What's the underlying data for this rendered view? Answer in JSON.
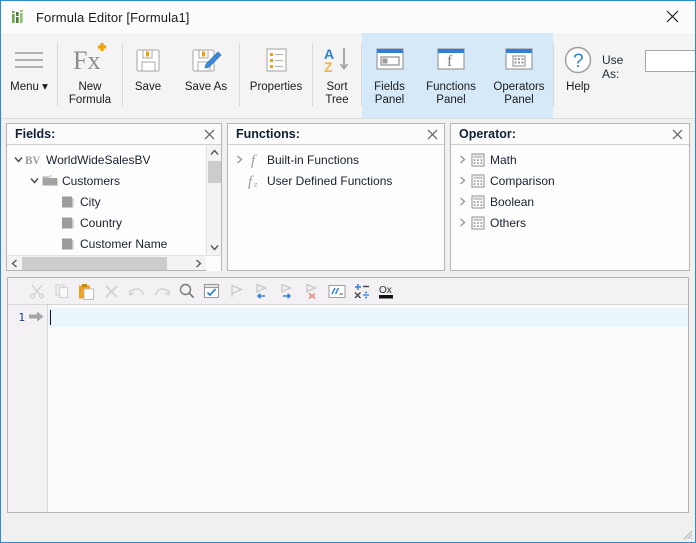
{
  "window": {
    "title": "Formula Editor [Formula1]",
    "app_icon": "bar-chart-icon",
    "close_label": "✕",
    "accent_color": "#2e8bd0"
  },
  "ribbon": {
    "items": [
      {
        "id": "menu",
        "icon": "hamburger-menu-icon",
        "label": "Menu ▾",
        "active": false
      },
      {
        "id": "new-formula",
        "icon": "fx-plus-icon",
        "label": "New\nFormula",
        "active": false
      },
      {
        "id": "save",
        "icon": "floppy-disk-icon",
        "label": "Save",
        "active": false
      },
      {
        "id": "save-as",
        "icon": "floppy-pencil-icon",
        "label": "Save As",
        "active": false
      },
      {
        "id": "properties",
        "icon": "list-properties-icon",
        "label": "Properties",
        "active": false
      },
      {
        "id": "sort-tree",
        "icon": "sort-az-icon",
        "label": "Sort\nTree",
        "active": false
      },
      {
        "id": "fields-panel",
        "icon": "fields-window-icon",
        "label": "Fields\nPanel",
        "active": true
      },
      {
        "id": "functions-panel",
        "icon": "function-window-icon",
        "label": "Functions\nPanel",
        "active": true
      },
      {
        "id": "operators-panel",
        "icon": "calculator-window-icon",
        "label": "Operators\nPanel",
        "active": true
      },
      {
        "id": "help",
        "icon": "question-circle-icon",
        "label": "Help",
        "active": false
      }
    ],
    "use_as": {
      "label": "Use As:",
      "value": "",
      "placeholder": "",
      "dropdown_icon": "chevron-down-icon"
    }
  },
  "panels": [
    {
      "id": "fields",
      "title": "Fields:",
      "close_icon": "close-icon",
      "has_vscroll": true,
      "has_hscroll": true,
      "nodes": [
        {
          "label": "WorldWideSalesBV",
          "icon": "bv-cube-icon",
          "indent": 0,
          "twisty": "expanded"
        },
        {
          "label": "Customers",
          "icon": "folder-icon",
          "indent": 1,
          "twisty": "expanded"
        },
        {
          "label": "City",
          "icon": "column-icon",
          "indent": 2,
          "twisty": "none"
        },
        {
          "label": "Country",
          "icon": "column-icon",
          "indent": 2,
          "twisty": "none"
        },
        {
          "label": "Customer Name",
          "icon": "column-icon",
          "indent": 2,
          "twisty": "none"
        }
      ]
    },
    {
      "id": "functions",
      "title": "Functions:",
      "close_icon": "close-icon",
      "has_vscroll": false,
      "has_hscroll": false,
      "nodes": [
        {
          "label": "Built-in Functions",
          "icon": "function-f-icon",
          "indent": 0,
          "twisty": "collapsed"
        },
        {
          "label": "User Defined Functions",
          "icon": "function-fz-icon",
          "indent": 0,
          "twisty": "none"
        }
      ]
    },
    {
      "id": "operator",
      "title": "Operator:",
      "close_icon": "close-icon",
      "has_vscroll": false,
      "has_hscroll": false,
      "nodes": [
        {
          "label": "Math",
          "icon": "calculator-icon",
          "indent": 0,
          "twisty": "collapsed"
        },
        {
          "label": "Comparison",
          "icon": "calculator-icon",
          "indent": 0,
          "twisty": "collapsed"
        },
        {
          "label": "Boolean",
          "icon": "calculator-icon",
          "indent": 0,
          "twisty": "collapsed"
        },
        {
          "label": "Others",
          "icon": "calculator-icon",
          "indent": 0,
          "twisty": "collapsed"
        }
      ]
    }
  ],
  "editor": {
    "toolbar": [
      {
        "id": "cut",
        "icon": "scissors-icon",
        "enabled": false
      },
      {
        "id": "copy",
        "icon": "copy-icon",
        "enabled": false
      },
      {
        "id": "paste",
        "icon": "paste-icon",
        "enabled": true
      },
      {
        "id": "delete",
        "icon": "x-delete-icon",
        "enabled": false
      },
      {
        "id": "undo",
        "icon": "undo-arrow-icon",
        "enabled": false
      },
      {
        "id": "redo",
        "icon": "redo-arrow-icon",
        "enabled": false
      },
      {
        "id": "find",
        "icon": "magnifier-icon",
        "enabled": true
      },
      {
        "id": "check-syntax",
        "icon": "checkbox-window-icon",
        "enabled": true
      },
      {
        "id": "run",
        "icon": "play-flag-icon",
        "enabled": false
      },
      {
        "id": "step-back",
        "icon": "flag-left-arrow-icon",
        "enabled": false
      },
      {
        "id": "step-forward",
        "icon": "flag-right-arrow-icon",
        "enabled": false
      },
      {
        "id": "stop",
        "icon": "flag-x-icon",
        "enabled": false
      },
      {
        "id": "comment",
        "icon": "comment-slashes-icon",
        "enabled": true
      },
      {
        "id": "operators-insert",
        "icon": "plus-minus-icon",
        "enabled": true
      },
      {
        "id": "hex-mode",
        "icon": "ox-hex-icon",
        "enabled": true
      }
    ],
    "lines": [
      {
        "number": "1",
        "marker": "current-line-arrow-icon",
        "text": "",
        "active": true
      }
    ]
  }
}
